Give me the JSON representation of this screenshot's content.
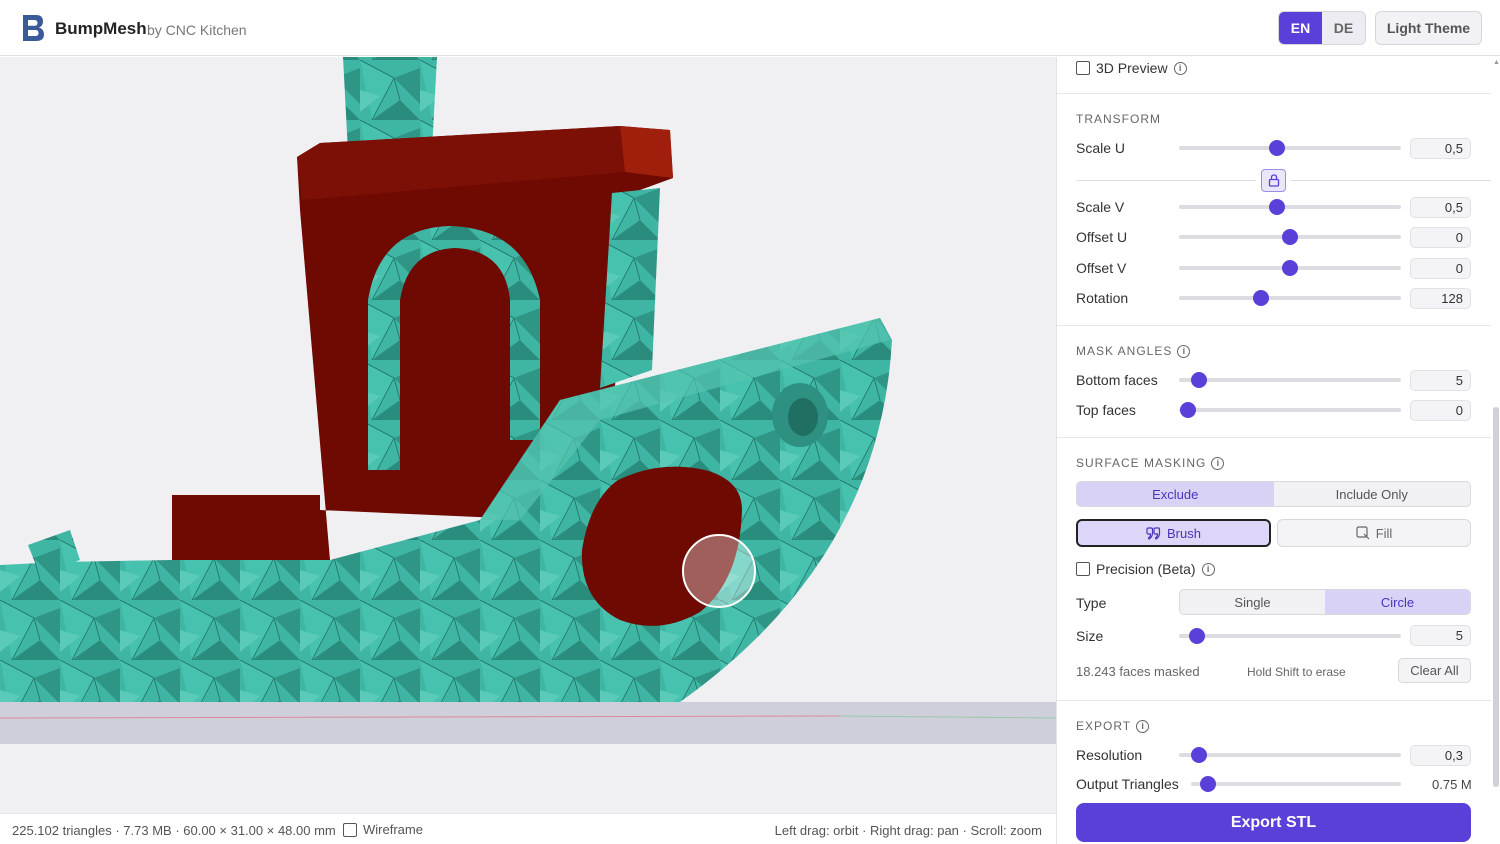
{
  "header": {
    "brand": "BumpMesh",
    "brand_sub": "by CNC Kitchen",
    "languages": [
      "EN",
      "DE"
    ],
    "active_language": "EN",
    "theme_button": "Light Theme"
  },
  "statusbar": {
    "stats": "225.102 triangles · 7.73 MB · 60.00 × 31.00 × 48.00 mm",
    "wireframe_label": "Wireframe",
    "wireframe_checked": false,
    "hints": "Left drag: orbit  ·  Right drag: pan  ·  Scroll: zoom"
  },
  "panel": {
    "preview_label": "3D Preview",
    "transform": {
      "title": "TRANSFORM",
      "rows": [
        {
          "label": "Scale U",
          "value": "0,5",
          "level": 0.44
        },
        {
          "label": "Scale V",
          "value": "0,5",
          "level": 0.44
        },
        {
          "label": "Offset U",
          "value": "0",
          "level": 0.5
        },
        {
          "label": "Offset V",
          "value": "0",
          "level": 0.5
        },
        {
          "label": "Rotation",
          "value": "128",
          "level": 0.37
        }
      ]
    },
    "mask_angles": {
      "title": "MASK ANGLES",
      "rows": [
        {
          "label": "Bottom faces",
          "value": "5",
          "level": 0.09
        },
        {
          "label": "Top faces",
          "value": "0",
          "level": 0.04
        }
      ]
    },
    "surface_masking": {
      "title": "SURFACE MASKING",
      "mode_options": [
        "Exclude",
        "Include Only"
      ],
      "mode_selected": "Exclude",
      "brush_label": "Brush",
      "fill_label": "Fill",
      "precision_label": "Precision (Beta)",
      "type_label": "Type",
      "type_options": [
        "Single",
        "Circle"
      ],
      "type_selected": "Circle",
      "size_label": "Size",
      "size_value": "5",
      "size_level": 0.08,
      "faces_masked": "18.243 faces masked",
      "shift_hint": "Hold Shift to erase",
      "clear_all": "Clear All"
    },
    "export": {
      "title": "EXPORT",
      "resolution_label": "Resolution",
      "resolution_value": "0,3",
      "resolution_level": 0.09,
      "output_label": "Output Triangles",
      "output_value": "0.75 M",
      "output_level": 0.08,
      "export_button": "Export STL"
    }
  },
  "colors": {
    "accent": "#5b3fd9",
    "model_teal": "#3fb5a3",
    "mask_red": "#6e0a02"
  }
}
